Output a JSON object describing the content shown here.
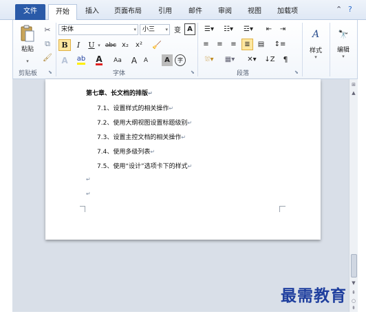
{
  "tabs": {
    "file": "文件",
    "home": "开始",
    "insert": "插入",
    "layout": "页面布局",
    "references": "引用",
    "mailings": "邮件",
    "review": "审阅",
    "view": "视图",
    "addins": "加载项"
  },
  "ribbon": {
    "clipboard": {
      "paste_label": "粘贴",
      "group_label": "剪贴板"
    },
    "font": {
      "font_name": "宋体",
      "font_size": "小三",
      "bold": "B",
      "italic": "I",
      "underline": "U",
      "strike": "abc",
      "subscript": "x₂",
      "superscript": "x²",
      "change_case": "Aa",
      "grow": "A",
      "shrink": "A",
      "char_shading": "A",
      "enclose": "字",
      "phonetic": "变",
      "char_border": "A",
      "group_label": "字体"
    },
    "paragraph": {
      "group_label": "段落"
    },
    "styles": {
      "label": "样式"
    },
    "editing": {
      "label": "编辑"
    }
  },
  "document": {
    "heading": "第七章、长文档的排版",
    "items": [
      "7.1、设置样式的相关操作",
      "7.2、使用大纲视图设置标题级别",
      "7.3、设置主控文档的相关操作",
      "7.4、使用多级列表",
      "7.5、使用“设计”选项卡下的样式"
    ],
    "paragraph_mark": "↵"
  },
  "watermark": "最需教育"
}
